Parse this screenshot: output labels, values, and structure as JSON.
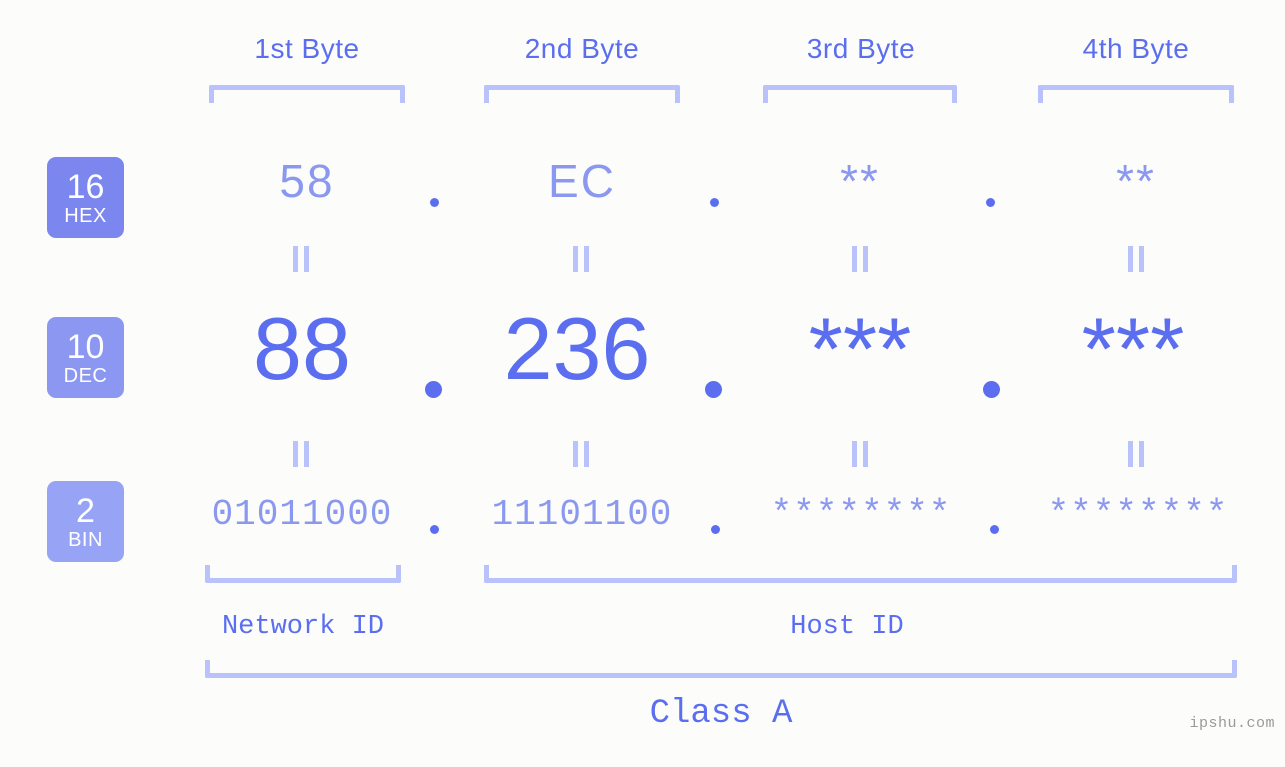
{
  "background_color": "#fcfdfa",
  "accent_color": "#5b6ef0",
  "accent_light_color": "#8b98ef",
  "bracket_color": "#b9c2fb",
  "header": {
    "byte_labels": [
      {
        "label": "1st Byte"
      },
      {
        "label": "2nd Byte"
      },
      {
        "label": "3rd Byte"
      },
      {
        "label": "4th Byte"
      }
    ]
  },
  "bases": [
    {
      "num": "16",
      "name": "HEX",
      "color": "#7b86ef"
    },
    {
      "num": "10",
      "name": "DEC",
      "color": "#8c97f2"
    },
    {
      "num": "2",
      "name": "BIN",
      "color": "#97a4f6"
    }
  ],
  "rows": {
    "hex": {
      "base_num": "16",
      "base_name": "HEX",
      "values": [
        "58",
        "EC",
        "**",
        "**"
      ],
      "separator": "."
    },
    "dec": {
      "base_num": "10",
      "base_name": "DEC",
      "values": [
        "88",
        "236",
        "***",
        "***"
      ],
      "separator": "."
    },
    "bin": {
      "base_num": "2",
      "base_name": "BIN",
      "values": [
        "01011000",
        "11101100",
        "********",
        "********"
      ],
      "separator": "."
    }
  },
  "id_labels": {
    "network": "Network ID",
    "host": "Host ID"
  },
  "class_label": "Class A",
  "watermark": "ipshu.com",
  "equality_marks": {
    "glyph": "=",
    "count_top": 4,
    "count_bottom": 4
  }
}
